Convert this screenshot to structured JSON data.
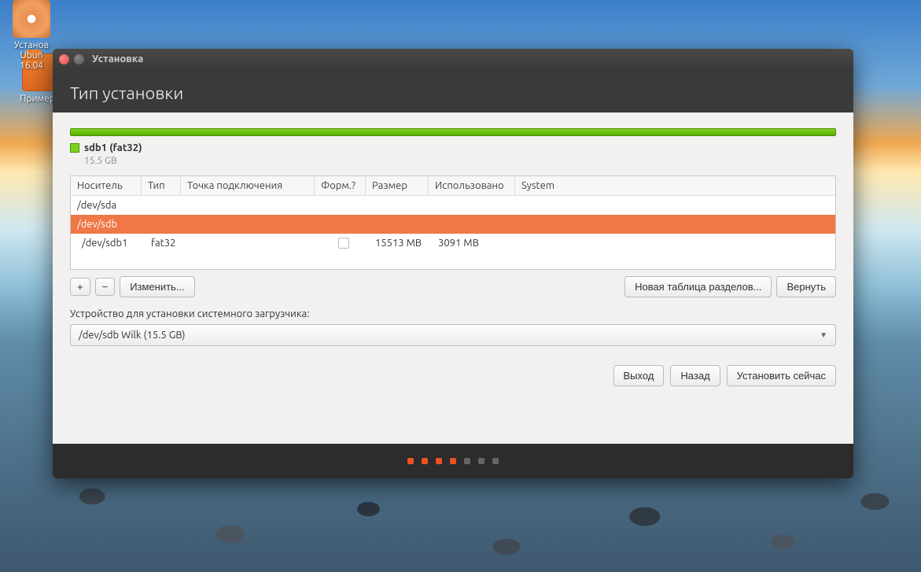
{
  "desktop": {
    "icon1_label": "Примеры",
    "icon2_line1": "Установ",
    "icon2_line2": "Ubun",
    "icon2_line3": "16.04"
  },
  "window": {
    "title": "Установка",
    "page_title": "Тип установки"
  },
  "disk": {
    "name": "sdb1 (fat32)",
    "size": "15.5 GB"
  },
  "columns": {
    "device": "Носитель",
    "type": "Тип",
    "mount": "Точка подключения",
    "format": "Форм.?",
    "size": "Размер",
    "used": "Использовано",
    "system": "System"
  },
  "rows": [
    {
      "device": "/dev/sda",
      "type": "",
      "mount": "",
      "size": "",
      "used": "",
      "selected": false,
      "indent": false,
      "fmt": false
    },
    {
      "device": "/dev/sdb",
      "type": "",
      "mount": "",
      "size": "",
      "used": "",
      "selected": true,
      "indent": false,
      "fmt": false
    },
    {
      "device": "/dev/sdb1",
      "type": "fat32",
      "mount": "",
      "size": "15513 MB",
      "used": "3091 MB",
      "selected": false,
      "indent": true,
      "fmt": true
    }
  ],
  "toolbar": {
    "add": "+",
    "remove": "−",
    "change": "Изменить...",
    "new_table": "Новая таблица разделов...",
    "revert": "Вернуть"
  },
  "bootloader": {
    "label": "Устройство для установки системного загрузчика:",
    "value": "/dev/sdb   Wilk  (15.5 GB)"
  },
  "footer": {
    "quit": "Выход",
    "back": "Назад",
    "install": "Установить сейчас"
  }
}
